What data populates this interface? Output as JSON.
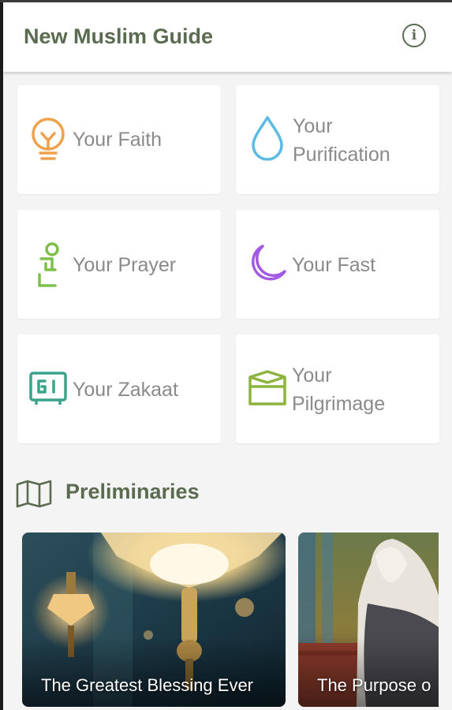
{
  "app": {
    "title": "New Muslim Guide",
    "colors": {
      "primary": "#5a6b4f",
      "card_text": "#8a8a8a",
      "background": "#f4f4f4"
    }
  },
  "toolbar": {
    "info_icon": "info-circle-icon"
  },
  "topics": [
    {
      "line1": "Your Faith",
      "line2": "",
      "icon": "lightbulb-icon",
      "color": "#f0a04b"
    },
    {
      "line1": "Your",
      "line2": "Purification",
      "icon": "water-drop-icon",
      "color": "#5bbbe3"
    },
    {
      "line1": "Your Prayer",
      "line2": "",
      "icon": "prayer-icon",
      "color": "#7cc04a"
    },
    {
      "line1": "Your Fast",
      "line2": "",
      "icon": "crescent-moon-icon",
      "color": "#a25be0"
    },
    {
      "line1": "Your Zakaat",
      "line2": "",
      "icon": "safe-icon",
      "color": "#3aa38a"
    },
    {
      "line1": "Your",
      "line2": "Pilgrimage",
      "icon": "kaaba-icon",
      "color": "#8cb43e"
    }
  ],
  "preliminaries": {
    "title": "Preliminaries",
    "icon": "map-icon",
    "lessons": [
      {
        "caption": "The Greatest Blessing Ever"
      },
      {
        "caption": "The Purpose o"
      }
    ]
  }
}
